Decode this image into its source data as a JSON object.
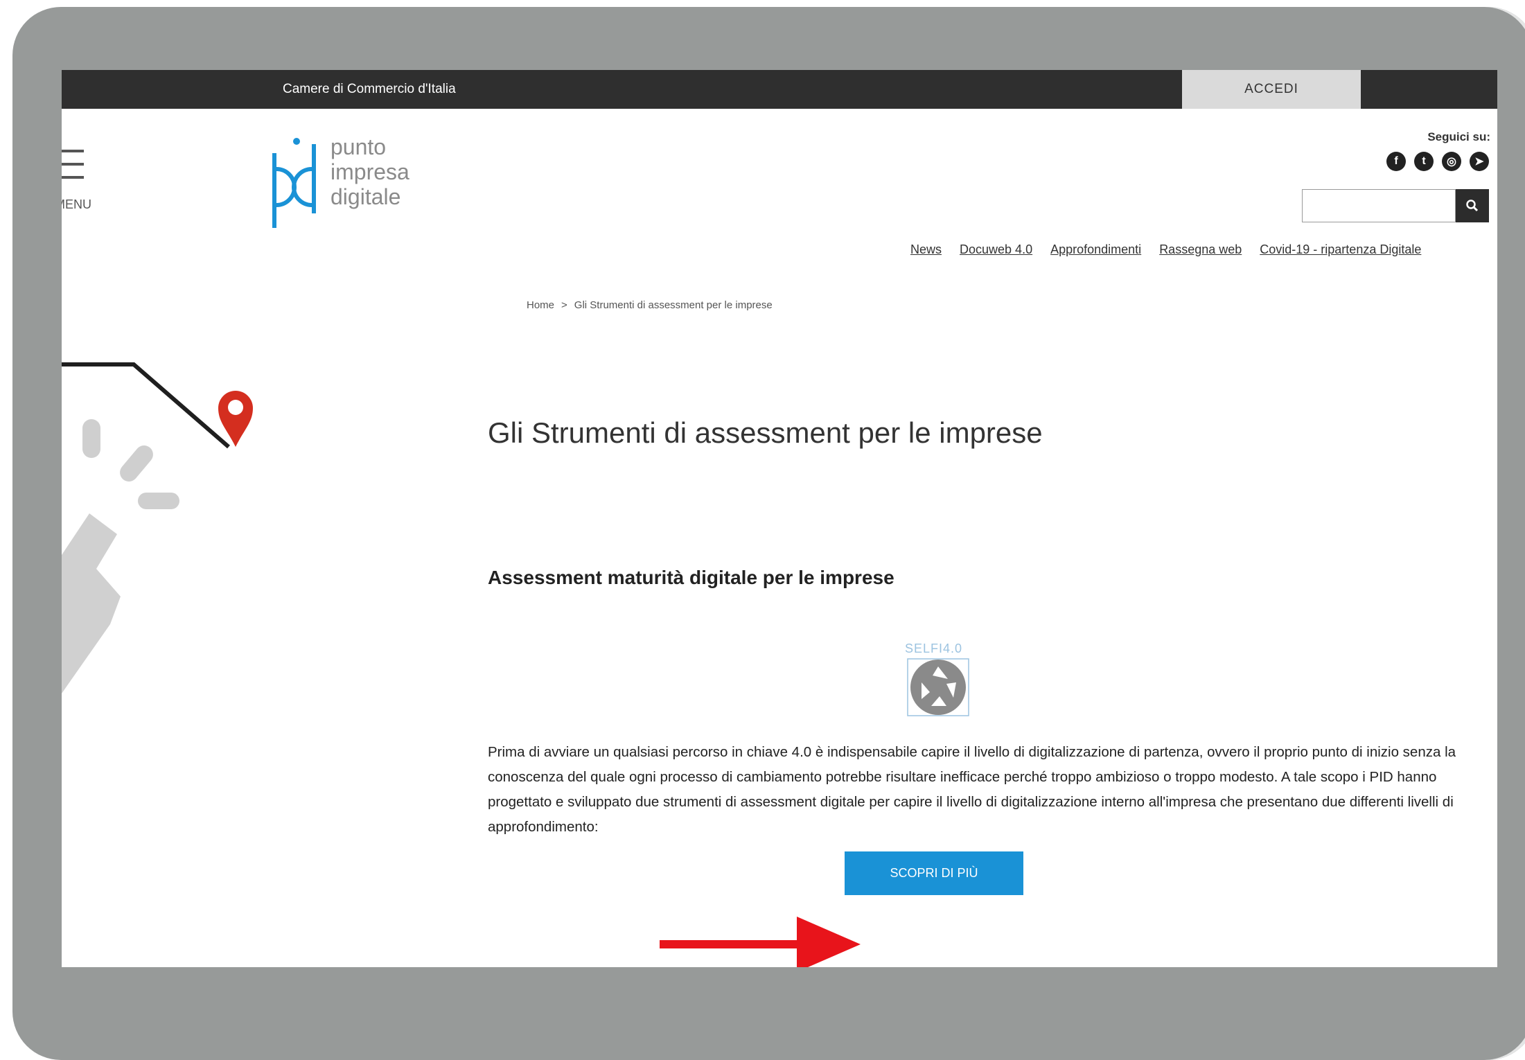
{
  "topbar": {
    "brand": "Camere di Commercio d'Italia",
    "login_label": "ACCEDI"
  },
  "menu": {
    "label": "MENU"
  },
  "logo": {
    "line1": "punto",
    "line2": "impresa",
    "line3": "digitale",
    "mark": "pid"
  },
  "social": {
    "label": "Seguici su:",
    "icons": [
      "facebook-icon",
      "twitter-icon",
      "instagram-icon",
      "telegram-icon"
    ]
  },
  "search": {
    "placeholder": "",
    "icon": "search-icon"
  },
  "nav": {
    "items": [
      "News",
      "Docuweb 4.0",
      "Approfondimenti",
      "Rassegna web",
      "Covid-19 - ripartenza Digitale"
    ]
  },
  "breadcrumb": {
    "home": "Home",
    "separator": ">",
    "current": "Gli Strumenti di assessment per le imprese"
  },
  "main": {
    "title": "Gli Strumenti di assessment per le imprese",
    "section_title": "Assessment maturità digitale per le imprese",
    "self_logo_text": "SELFI4.0",
    "body": "Prima di avviare un qualsiasi percorso in chiave 4.0 è indispensabile capire il livello di digitalizzazione di partenza, ovvero il proprio punto di inizio senza la conoscenza del quale ogni processo di cambiamento potrebbe risultare inefficace perché troppo ambizioso o troppo modesto. A tale scopo i PID hanno progettato e sviluppato due strumenti di assessment digitale per capire il livello di digitalizzazione interno all'impresa che presentano due differenti livelli di approfondimento:",
    "cta_label": "SCOPRI DI PIÙ"
  },
  "colors": {
    "accent": "#1a92d6",
    "topbar": "#2f2f2f",
    "frame": "#979a99",
    "arrow": "#e8141b",
    "pin": "#d42e1f"
  }
}
